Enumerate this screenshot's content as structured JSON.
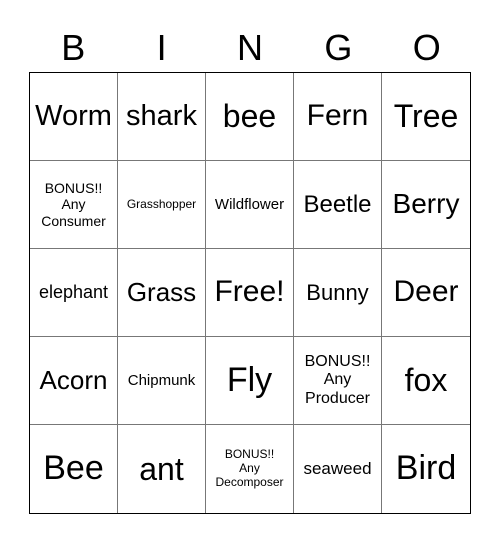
{
  "header": [
    "B",
    "I",
    "N",
    "G",
    "O"
  ],
  "cells": [
    "Worm",
    "shark",
    "bee",
    "Fern",
    "Tree",
    "BONUS!!\nAny\nConsumer",
    "Grasshopper",
    "Wildflower",
    "Beetle",
    "Berry",
    "elephant",
    "Grass",
    "Free!",
    "Bunny",
    "Deer",
    "Acorn",
    "Chipmunk",
    "Fly",
    "BONUS!!\nAny\nProducer",
    "fox",
    "Bee",
    "ant",
    "BONUS!!\nAny\nDecomposer",
    "seaweed",
    "Bird"
  ]
}
